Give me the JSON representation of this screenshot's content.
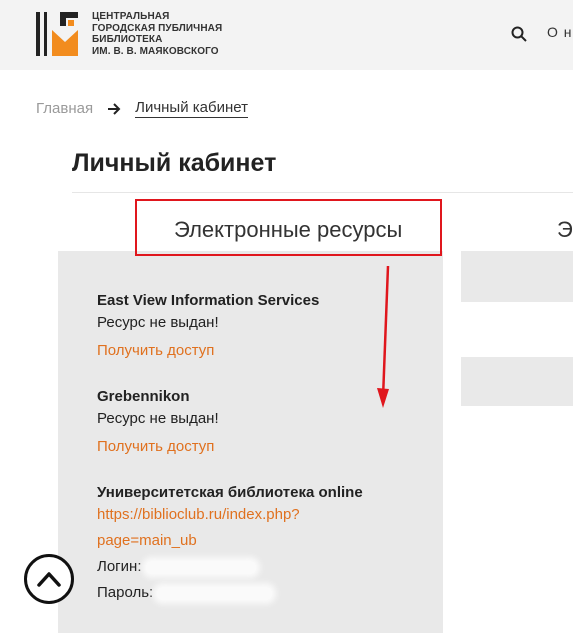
{
  "header": {
    "logo_lines": [
      "ЦЕНТРАЛЬНАЯ",
      "ГОРОДСКАЯ ПУБЛИЧНАЯ",
      "БИБЛИОТЕКА",
      "ИМ. В. В. МАЯКОВСКОГО"
    ],
    "nav_link": "О н",
    "accent": "#f28c1e"
  },
  "breadcrumb": {
    "home": "Главная",
    "current": "Личный кабинет"
  },
  "page_title": "Личный кабинет",
  "tabs": {
    "active": "Электронные ресурсы",
    "next": "Э"
  },
  "resources": [
    {
      "name": "East View Information Services",
      "status": "Ресурс не выдан!",
      "action": "Получить доступ"
    },
    {
      "name": "Grebennikon",
      "status": "Ресурс не выдан!",
      "action": "Получить доступ"
    },
    {
      "name": "Университетская библиотека online",
      "link_line1": "https://biblioclub.ru/index.php?",
      "link_line2": "page=main_ub",
      "login_label": "Логин:",
      "password_label": "Пароль:"
    }
  ],
  "colors": {
    "link": "#e0711f",
    "highlight": "#e0161d",
    "panel": "#e9e9e9"
  }
}
